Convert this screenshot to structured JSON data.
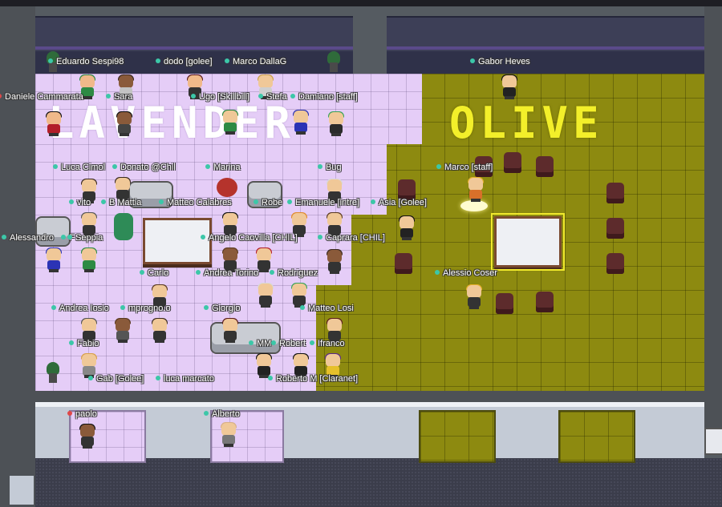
{
  "rooms": {
    "lavender": {
      "title": "LAVENDER",
      "color": "#e5cdf7"
    },
    "olive": {
      "title": "OLIVE",
      "color": "#8d8a10",
      "title_color": "#f3ef2a"
    }
  },
  "players": [
    {
      "name": "Eduardo Sespi98"
    },
    {
      "name": "dodo [golee]"
    },
    {
      "name": "Marco DallaG"
    },
    {
      "name": "Gabor Heves"
    },
    {
      "name": "Daniele Cammarata",
      "status_color": "#e04848"
    },
    {
      "name": "Sara"
    },
    {
      "name": "Ugo [Skillbill]"
    },
    {
      "name": "Stefa"
    },
    {
      "name": "Damiano [staff]"
    },
    {
      "name": "Luca Cimol"
    },
    {
      "name": "Donato @Chil"
    },
    {
      "name": "Marina"
    },
    {
      "name": "Bug"
    },
    {
      "name": "Marco [staff]"
    },
    {
      "name": "vito"
    },
    {
      "name": "B Mattia"
    },
    {
      "name": "Matteo Calabres"
    },
    {
      "name": "Robe"
    },
    {
      "name": "Emanuele [intre]"
    },
    {
      "name": "Asia [Golee]"
    },
    {
      "name": "Alessandro"
    },
    {
      "name": "F"
    },
    {
      "name": "Seppia"
    },
    {
      "name": "Angelo Caovilla [CHIL]"
    },
    {
      "name": "Caprara [CHIL]"
    },
    {
      "name": "Carlo"
    },
    {
      "name": "Andrea Torino"
    },
    {
      "name": "Rodriguez"
    },
    {
      "name": "Alessio Coser"
    },
    {
      "name": "Andrea Iosio"
    },
    {
      "name": "mprogno.o"
    },
    {
      "name": "Giorgio"
    },
    {
      "name": "Matteo Losi"
    },
    {
      "name": "Fabio"
    },
    {
      "name": "MM"
    },
    {
      "name": "Robert"
    },
    {
      "name": "Ifranco"
    },
    {
      "name": "Gab [Golee]"
    },
    {
      "name": "luca marcato"
    },
    {
      "name": "Roberto M [Claranet]"
    },
    {
      "name": "paolo",
      "status_color": "#e04848"
    },
    {
      "name": "Alberto"
    }
  ],
  "colors": {
    "online_dot": "#3cc7a8",
    "busy_dot": "#e04848",
    "selection_outline": "#f1ea2c"
  }
}
